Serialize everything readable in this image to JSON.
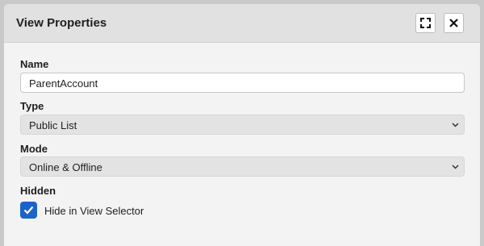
{
  "dialog": {
    "title": "View Properties",
    "expand_icon": "expand-icon",
    "close_icon": "close-icon"
  },
  "fields": {
    "name": {
      "label": "Name",
      "value": "ParentAccount"
    },
    "type": {
      "label": "Type",
      "value": "Public List"
    },
    "mode": {
      "label": "Mode",
      "value": "Online & Offline"
    },
    "hidden": {
      "label": "Hidden",
      "checkbox_label": "Hide in View Selector",
      "checked": true
    }
  },
  "colors": {
    "accent": "#1b63c9"
  }
}
